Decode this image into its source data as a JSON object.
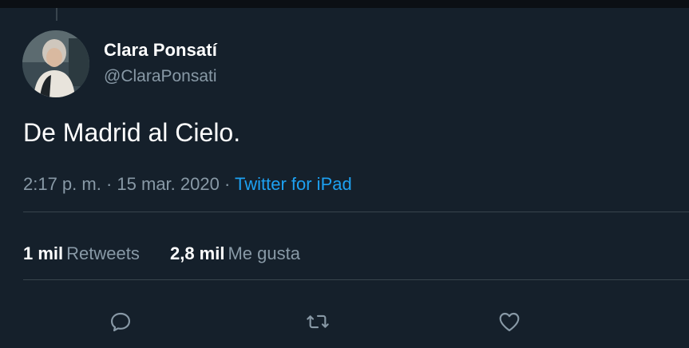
{
  "tweet": {
    "author": {
      "display_name": "Clara Ponsatí",
      "handle": "@ClaraPonsati"
    },
    "text": "De Madrid al Cielo.",
    "time": "2:17 p. m.",
    "separator": " · ",
    "date": "15 mar. 2020",
    "source": "Twitter for iPad",
    "stats": {
      "retweets_count": "1 mil",
      "retweets_label": "Retweets",
      "likes_count": "2,8 mil",
      "likes_label": "Me gusta"
    }
  },
  "actions": {
    "reply_icon": "reply-icon",
    "retweet_icon": "retweet-icon",
    "like_icon": "heart-icon"
  },
  "colors": {
    "background": "#15202b",
    "primary_text": "#ffffff",
    "secondary_text": "#8899a6",
    "link": "#1da1f2",
    "divider": "#38444d"
  }
}
